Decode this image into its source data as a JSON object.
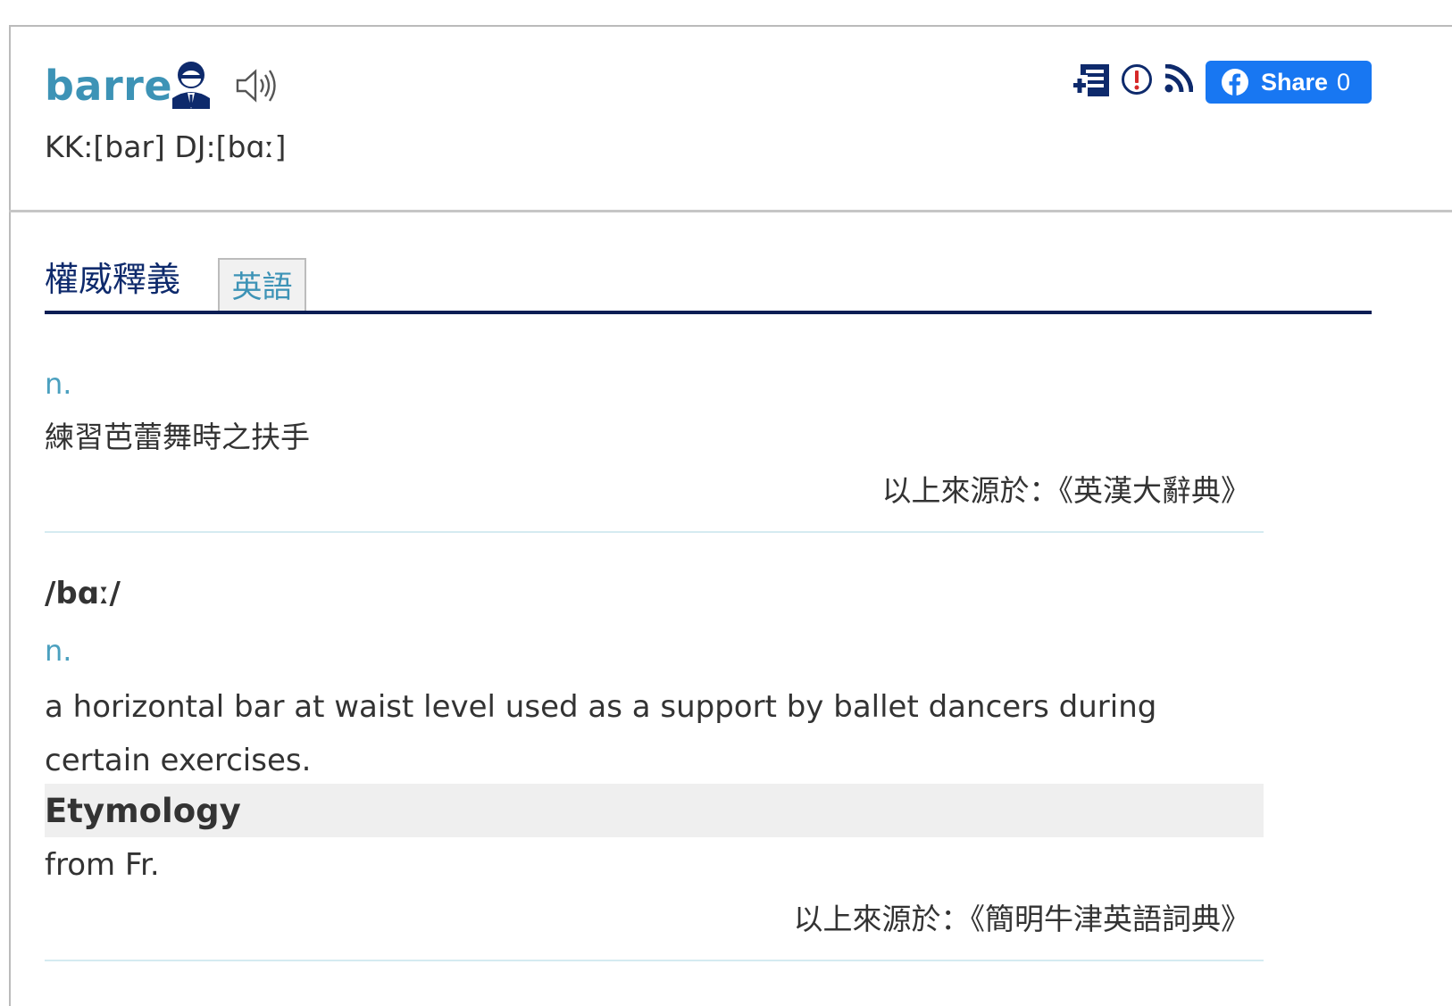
{
  "entry": {
    "word": "barre",
    "phonetic": "KK:[bar] DJ:[bɑː]"
  },
  "icons": {
    "person": "person-icon",
    "speaker": "speaker-icon",
    "add": "add-to-wordbook-icon",
    "report": "report-icon",
    "rss": "rss-icon",
    "facebook": "facebook-icon"
  },
  "share": {
    "label": "Share",
    "count": "0"
  },
  "tabs": {
    "title": "權威釋義",
    "english": "英語"
  },
  "sections": [
    {
      "pos": "n.",
      "definition": "練習芭蕾舞時之扶手",
      "source": "以上來源於：《英漢大辭典》"
    },
    {
      "pronunciation": "/bɑː/",
      "pos": "n.",
      "definition": "a horizontal bar at waist level used as a support by ballet dancers during certain exercises.",
      "etymology_heading": "Etymology",
      "etymology": "from Fr.",
      "source": "以上來源於：《簡明牛津英語詞典》"
    }
  ],
  "colors": {
    "word": "#3d93b6",
    "tab_title": "#0e2a6c",
    "tab_rule": "#0b1e54",
    "share_bg": "#1877f2",
    "pos": "#4ba0bf",
    "separator": "#d5ebf1"
  }
}
